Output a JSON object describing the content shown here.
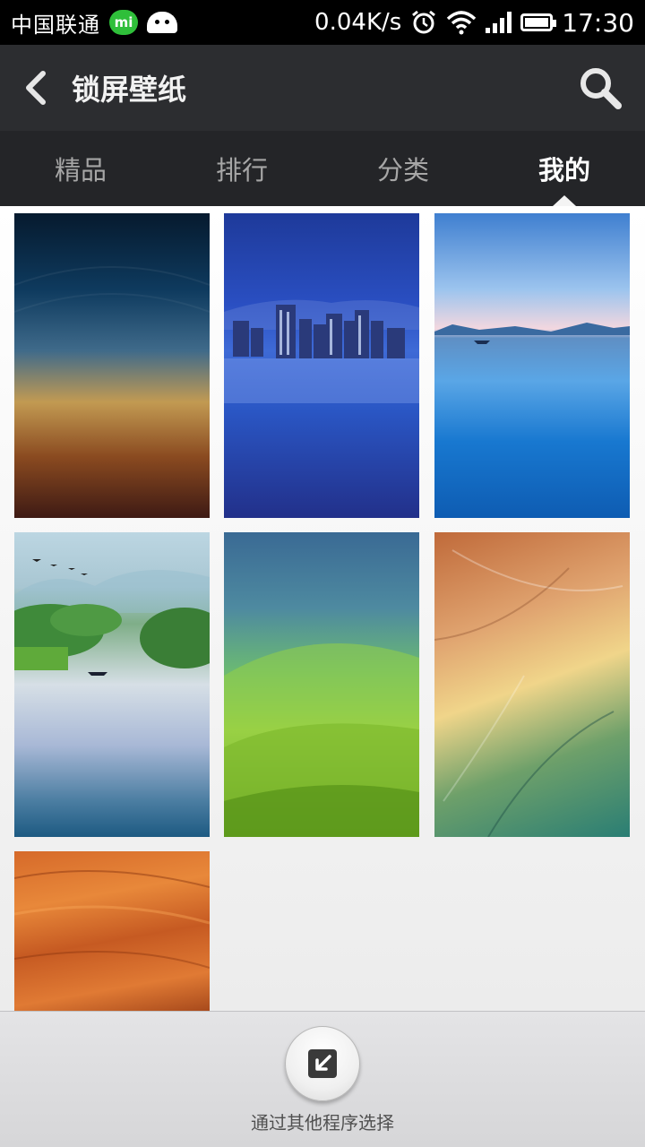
{
  "status_bar": {
    "carrier": "中国联通",
    "mi_badge": "mi",
    "net_speed": "0.04K/s",
    "time": "17:30",
    "icons": [
      "mi-chat-icon",
      "android-icon",
      "alarm-icon",
      "wifi-icon",
      "signal-icon",
      "battery-icon"
    ]
  },
  "action_bar": {
    "back_icon": "back-chevron-icon",
    "title": "锁屏壁纸",
    "search_icon": "search-icon"
  },
  "tabs": [
    {
      "label": "精品",
      "active": false
    },
    {
      "label": "排行",
      "active": false
    },
    {
      "label": "分类",
      "active": false
    },
    {
      "label": "我的",
      "active": true
    }
  ],
  "wallpapers": [
    {
      "name": "gradient-dusk"
    },
    {
      "name": "blue-city-skyline"
    },
    {
      "name": "lake-with-boat"
    },
    {
      "name": "misty-river-with-birds"
    },
    {
      "name": "green-hills"
    },
    {
      "name": "feathers"
    },
    {
      "name": "orange-wood-grain"
    }
  ],
  "bottom_bar": {
    "icon": "select-from-app-icon",
    "label": "通过其他程序选择"
  },
  "colors": {
    "action_bar": "#2c2d30",
    "tabs": "#242528",
    "status_bar": "#000000"
  }
}
